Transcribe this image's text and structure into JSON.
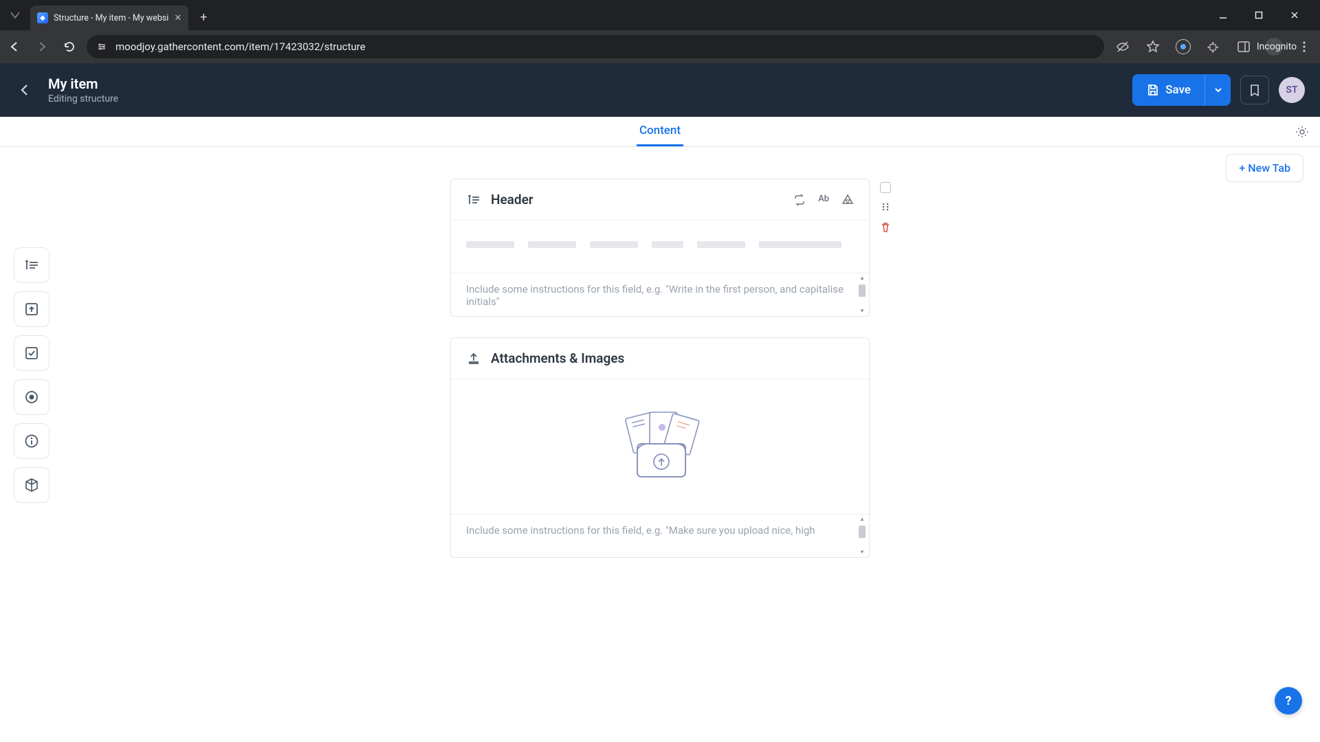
{
  "browser": {
    "tab_title": "Structure - My item - My websi",
    "url": "moodjoy.gathercontent.com/item/17423032/structure",
    "incognito_label": "Incognito"
  },
  "header": {
    "title": "My item",
    "subtitle": "Editing structure",
    "save_label": "Save",
    "avatar_initials": "ST"
  },
  "subnav": {
    "active_tab": "Content",
    "new_tab_label": "+ New Tab"
  },
  "cards": {
    "header_field": {
      "label": "Header",
      "ab_label": "Ab",
      "instructions_placeholder": "Include some instructions for this field, e.g. \"Write in the first person, and capitalise initials\""
    },
    "attachments": {
      "label": "Attachments & Images",
      "instructions_placeholder": "Include some instructions for this field, e.g. \"Make sure you upload nice, high"
    }
  },
  "help_fab": "?"
}
